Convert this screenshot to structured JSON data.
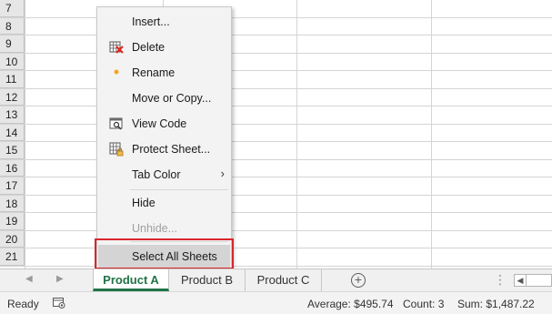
{
  "grid": {
    "rows": [
      "7",
      "8",
      "9",
      "10",
      "11",
      "12",
      "13",
      "14",
      "15",
      "16",
      "17",
      "18",
      "19",
      "20",
      "21"
    ]
  },
  "context_menu": {
    "items": [
      {
        "label": "Insert...",
        "icon": "none"
      },
      {
        "label": "Delete",
        "icon": "delete-sheet-icon"
      },
      {
        "label": "Rename",
        "icon": "dot-icon"
      },
      {
        "label": "Move or Copy...",
        "icon": "none"
      },
      {
        "label": "View Code",
        "icon": "view-code-icon"
      },
      {
        "label": "Protect Sheet...",
        "icon": "protect-sheet-icon"
      },
      {
        "label": "Tab Color",
        "icon": "none",
        "submenu_arrow": "›"
      },
      {
        "label": "Hide",
        "icon": "none"
      },
      {
        "label": "Unhide...",
        "icon": "none",
        "disabled": true
      },
      {
        "label": "Select All Sheets",
        "icon": "none",
        "highlighted": true
      }
    ]
  },
  "tabs": {
    "nav_prev": "◀",
    "nav_next": "▶",
    "sheets": [
      {
        "label": "Product A",
        "active": true
      },
      {
        "label": "Product B",
        "active": false
      },
      {
        "label": "Product C",
        "active": false
      }
    ],
    "add_sheet": "+",
    "more": "⋮",
    "scroll_left": "◀"
  },
  "status": {
    "ready": "Ready",
    "average": "Average:  $495.74",
    "count": "Count: 3",
    "sum": "Sum:  $1,487.22"
  },
  "colors": {
    "accent_green": "#217346",
    "highlight_red": "#d9262c",
    "delete_red": "#e2241b",
    "rename_dot": "#f7a523"
  }
}
